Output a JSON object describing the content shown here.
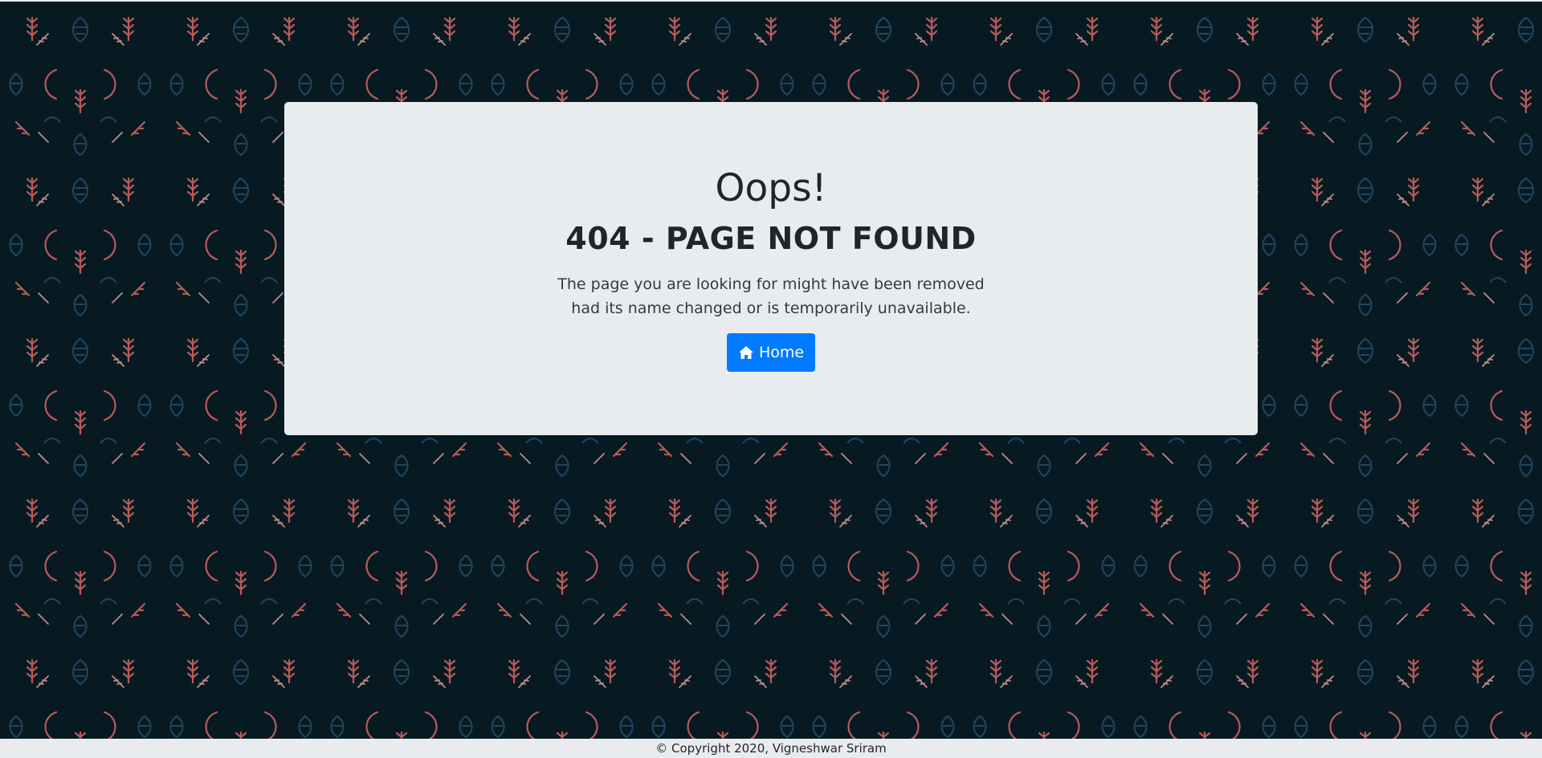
{
  "page": {
    "background_color": "#071a22",
    "pattern_colors": [
      "#b85a58",
      "#1f4762",
      "#c08a83"
    ]
  },
  "error": {
    "title": "Oops!",
    "subtitle": "404 - PAGE NOT FOUND",
    "message_line1": "The page you are looking for might have been removed",
    "message_line2": "had its name changed or is temporarily unavailable."
  },
  "home_button": {
    "label": "Home",
    "icon": "home-icon",
    "color": "#007bff"
  },
  "footer": {
    "copyright": "© Copyright 2020, Vigneshwar Sriram"
  }
}
